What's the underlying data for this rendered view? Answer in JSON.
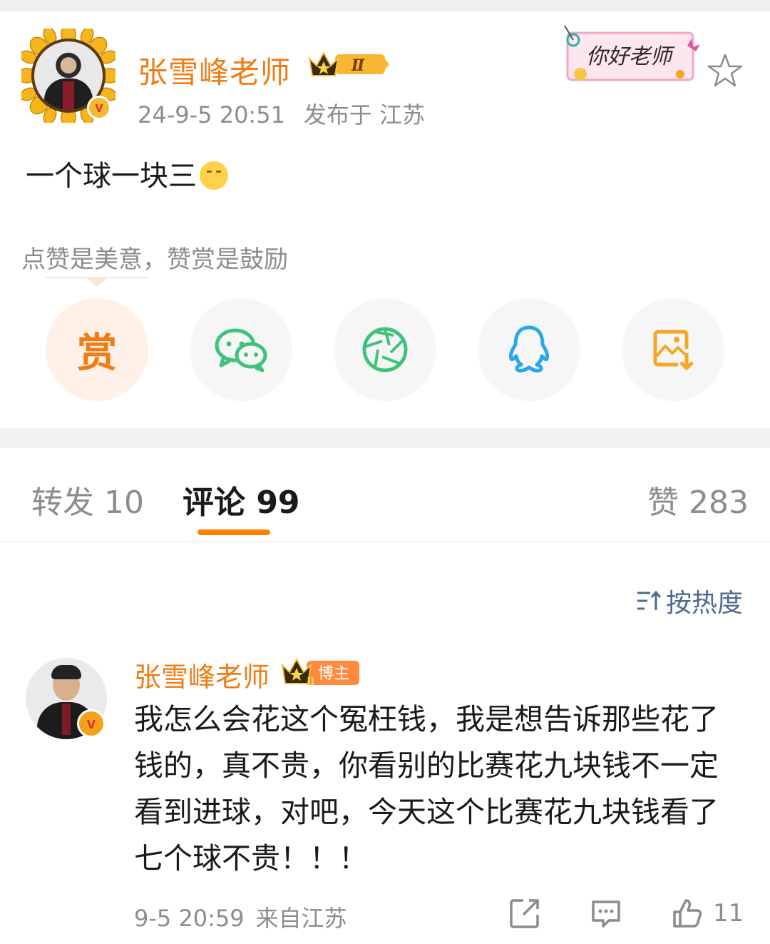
{
  "post": {
    "author": "张雪峰老师",
    "level_badge": "Ⅱ",
    "time": "24-9-5 20:51",
    "location": "发布于 江苏",
    "text": "一个球一块三",
    "sticker_text": "你好老师",
    "reward_tip": "点赞是美意，赞赏是鼓励",
    "share_buttons": [
      {
        "name": "reward",
        "label": "赏",
        "icon": "reward-icon"
      },
      {
        "name": "wechat",
        "icon": "wechat-icon"
      },
      {
        "name": "moments",
        "icon": "moments-icon"
      },
      {
        "name": "qq",
        "icon": "qq-icon"
      },
      {
        "name": "save-image",
        "icon": "save-image-icon"
      }
    ]
  },
  "tabs": {
    "repost": "转发 10",
    "comments": "评论 99",
    "likes": "赞 283"
  },
  "sort": {
    "label": "按热度",
    "icon": "sort-icon"
  },
  "comment": {
    "author": "张雪峰老师",
    "badge_label": "博主",
    "level_badge": "Ⅱ",
    "text": "我怎么会花这个冤枉钱，我是想告诉那些花了钱的，真不贵，你看别的比赛花九块钱不一定看到进球，对吧，今天这个比赛花九块钱看了七个球不贵！！！",
    "time": "9-5 20:59",
    "location": "来自江苏",
    "like_count": "11"
  },
  "colors": {
    "accent": "#f07c15",
    "tab_underline": "#ff8200",
    "sort": "#4e6a8e",
    "wechat": "#3fc27a",
    "moments": "#3fc27a",
    "qq": "#2aa7e8",
    "save": "#f5a623"
  }
}
